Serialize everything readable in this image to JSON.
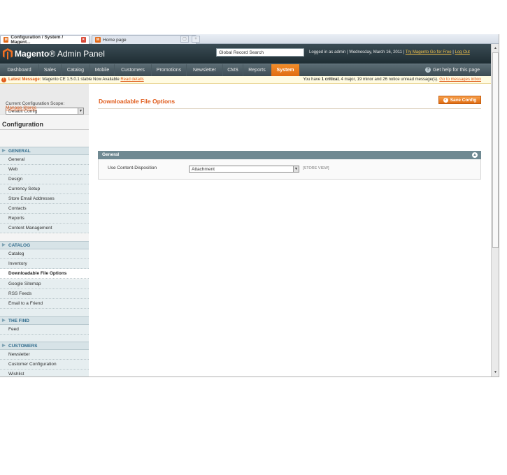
{
  "browser": {
    "tabs": [
      {
        "title": "Configuration / System / Magent..."
      },
      {
        "title": "Home page"
      }
    ]
  },
  "header": {
    "logo_brand": "Magento",
    "logo_suffix": "Admin Panel",
    "search_placeholder": "Global Record Search",
    "logged_in_text": "Logged in as admin  |  Wednesday, March 16, 2011  |",
    "try_link": "Try Magento Go for Free",
    "logout_link": "Log Out"
  },
  "nav": {
    "items": [
      "Dashboard",
      "Sales",
      "Catalog",
      "Mobile",
      "Customers",
      "Promotions",
      "Newsletter",
      "CMS",
      "Reports",
      "System"
    ],
    "active": "System",
    "help": "Get help for this page"
  },
  "messages": {
    "latest_label": "Latest Message:",
    "latest_text": "Magento CE 1.5.0.1 stable Now Available",
    "read_details": "Read details",
    "summary_prefix": "You have",
    "critical": "1 critical",
    "major": "4 major",
    "minor": "19 minor and",
    "notice": "26 notice unread message(s).",
    "go_to": "Go to messages inbox"
  },
  "sidebar": {
    "scope_label": "Current Configuration Scope:",
    "scope_value": "Default Config",
    "manage_stores": "Manage Stores",
    "title": "Configuration",
    "sections": [
      {
        "label": "GENERAL",
        "items": [
          "General",
          "Web",
          "Design",
          "Currency Setup",
          "Store Email Addresses",
          "Contacts",
          "Reports",
          "Content Management"
        ]
      },
      {
        "label": "CATALOG",
        "items": [
          "Catalog",
          "Inventory",
          "Downloadable File Options",
          "Google Sitemap",
          "RSS Feeds",
          "Email to a Friend"
        ]
      },
      {
        "label": "THE FIND",
        "items": [
          "Feed"
        ]
      },
      {
        "label": "CUSTOMERS",
        "items": [
          "Newsletter",
          "Customer Configuration",
          "Wishlist"
        ]
      }
    ],
    "active_item": "Downloadable File Options"
  },
  "main": {
    "heading": "Downloadable File Options",
    "save_button": "Save Config",
    "fieldset_title": "General",
    "field_label": "Use Content-Disposition",
    "field_value": "Attachment",
    "field_scope": "[STORE VIEW]"
  },
  "colors": {
    "accent": "#e05b1a",
    "header_bg": "#2b3a41",
    "nav_active": "#eb7b1e",
    "fieldset_head": "#6f8992"
  }
}
